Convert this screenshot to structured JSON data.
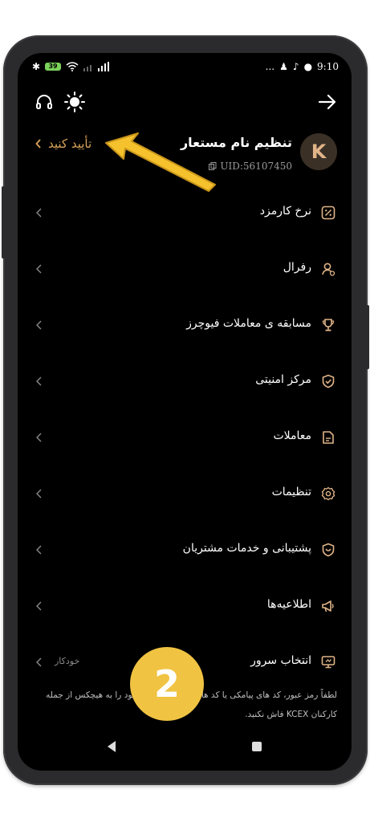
{
  "statusbar": {
    "battery": "39",
    "signal_text": "...",
    "time": "9:10"
  },
  "toolbar": {
    "support_icon": "headset-icon",
    "theme_icon": "sun-icon",
    "back_icon": "arrow-right-icon"
  },
  "profile": {
    "avatar_letter": "K",
    "name": "تنظیم نام مستعار",
    "uid": "UID:56107450",
    "verify_label": "تأیید کنید"
  },
  "menu": [
    {
      "label": "نرخ کارمزد",
      "icon": "percent-icon",
      "extra": ""
    },
    {
      "label": "رفرال",
      "icon": "user-plus-icon",
      "extra": ""
    },
    {
      "label": "مسابقه ی معاملات فیوچرز",
      "icon": "trophy-icon",
      "extra": ""
    },
    {
      "label": "مرکز امنیتی",
      "icon": "shield-check-icon",
      "extra": ""
    },
    {
      "label": "معاملات",
      "icon": "document-icon",
      "extra": ""
    },
    {
      "label": "تنظیمات",
      "icon": "gear-icon",
      "extra": ""
    },
    {
      "label": "پشتیبانی و خدمات مشتریان",
      "icon": "support-shield-icon",
      "extra": ""
    },
    {
      "label": "اطلاعیه‌ها",
      "icon": "megaphone-icon",
      "extra": ""
    },
    {
      "label": "انتخاب سرور",
      "icon": "server-monitor-icon",
      "extra": "خودکار"
    }
  ],
  "footer": {
    "warning": "لطفاً رمز عبور، کد های پیامکی یا کد های گوگل آتنتیکیتور خود را به هیچکس از جمله کارکنان KCEX فاش نکنید."
  },
  "annotation": {
    "step_number": "2"
  },
  "colors": {
    "accent": "#e0b488",
    "verify": "#d8a55a",
    "badge": "#f0c342",
    "arrow": "#f5c22e"
  }
}
